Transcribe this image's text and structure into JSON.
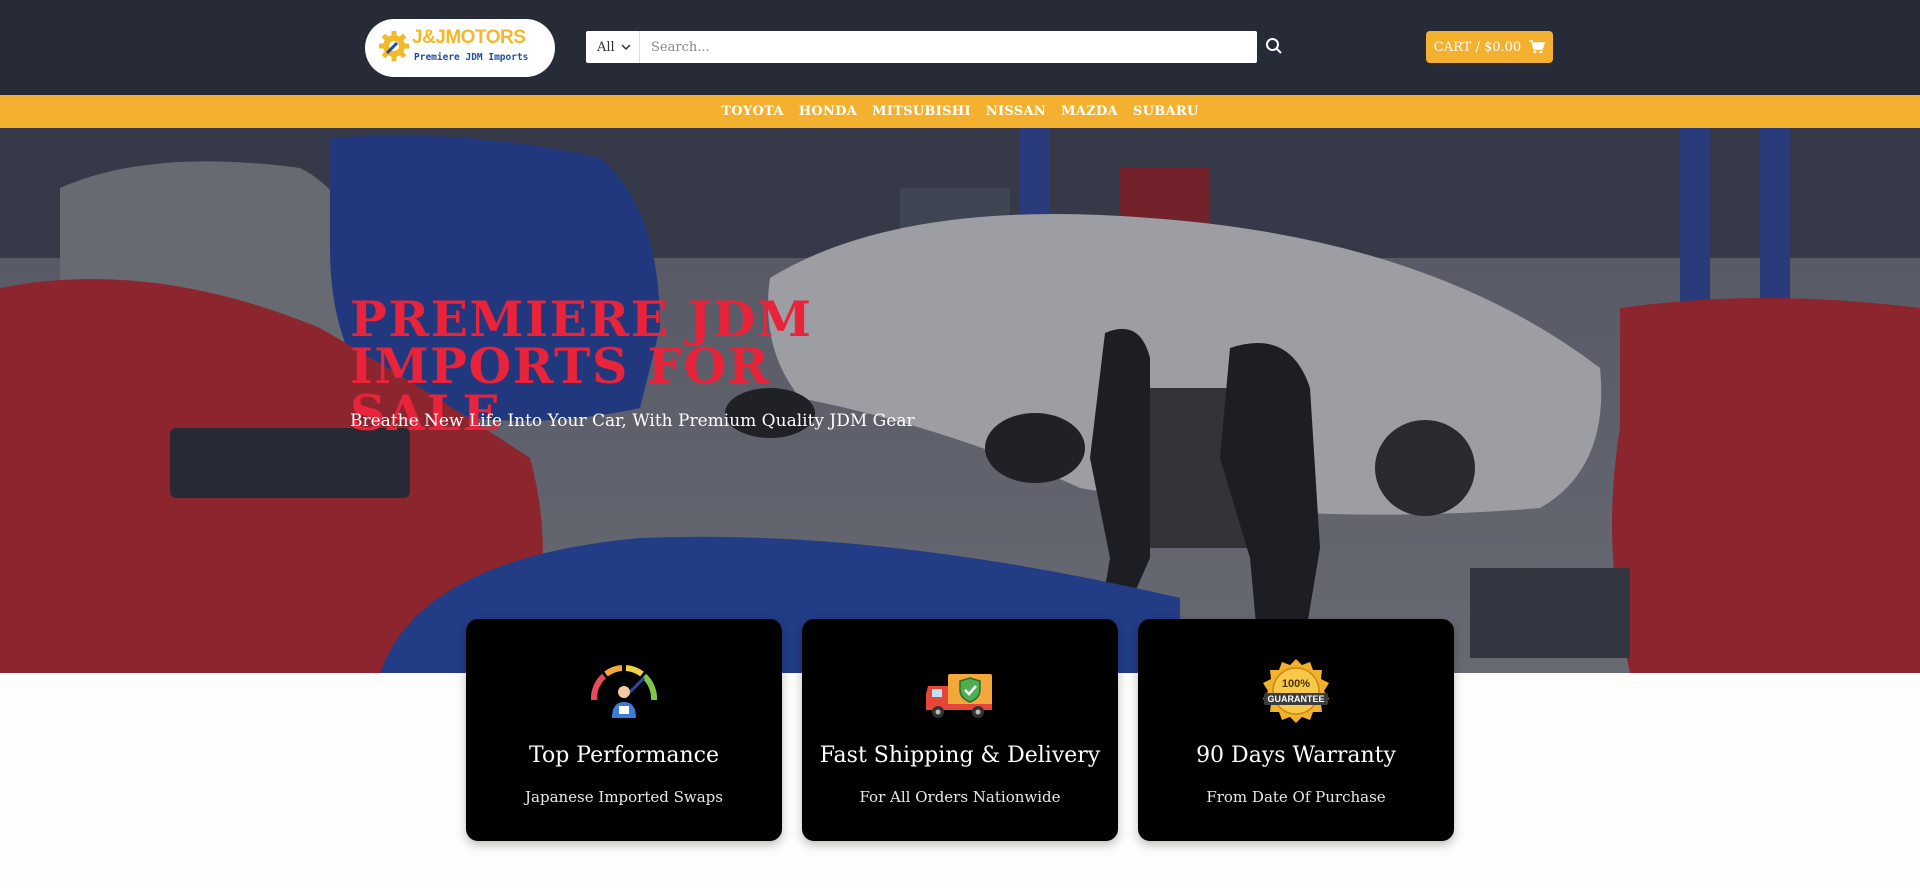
{
  "brand": {
    "logo_title": "J&JMOTORS",
    "logo_subtitle": "Premiere JDM Imports",
    "accent": "#f4b12f",
    "header_bg": "#272a37",
    "hero_title_color": "#e8233a"
  },
  "search": {
    "category": "All",
    "placeholder": "Search..."
  },
  "cart": {
    "label": "CART / $0.00"
  },
  "nav": {
    "items": [
      "TOYOTA",
      "HONDA",
      "MITSUBISHI",
      "NISSAN",
      "MAZDA",
      "SUBARU"
    ]
  },
  "hero": {
    "title": "PREMIERE JDM IMPORTS FOR SALE",
    "subtitle": "Breathe New Life Into Your Car, With Premium Quality JDM Gear"
  },
  "features": [
    {
      "icon": "speedometer-icon",
      "title": "Top Performance",
      "desc": "Japanese Imported Swaps"
    },
    {
      "icon": "delivery-truck-icon",
      "title": "Fast Shipping & Delivery",
      "desc": "For All Orders Nationwide"
    },
    {
      "icon": "guarantee-badge-icon",
      "title": "90 Days Warranty",
      "desc": "From Date Of Purchase",
      "badge_text": "100% GUARANTEE"
    }
  ]
}
